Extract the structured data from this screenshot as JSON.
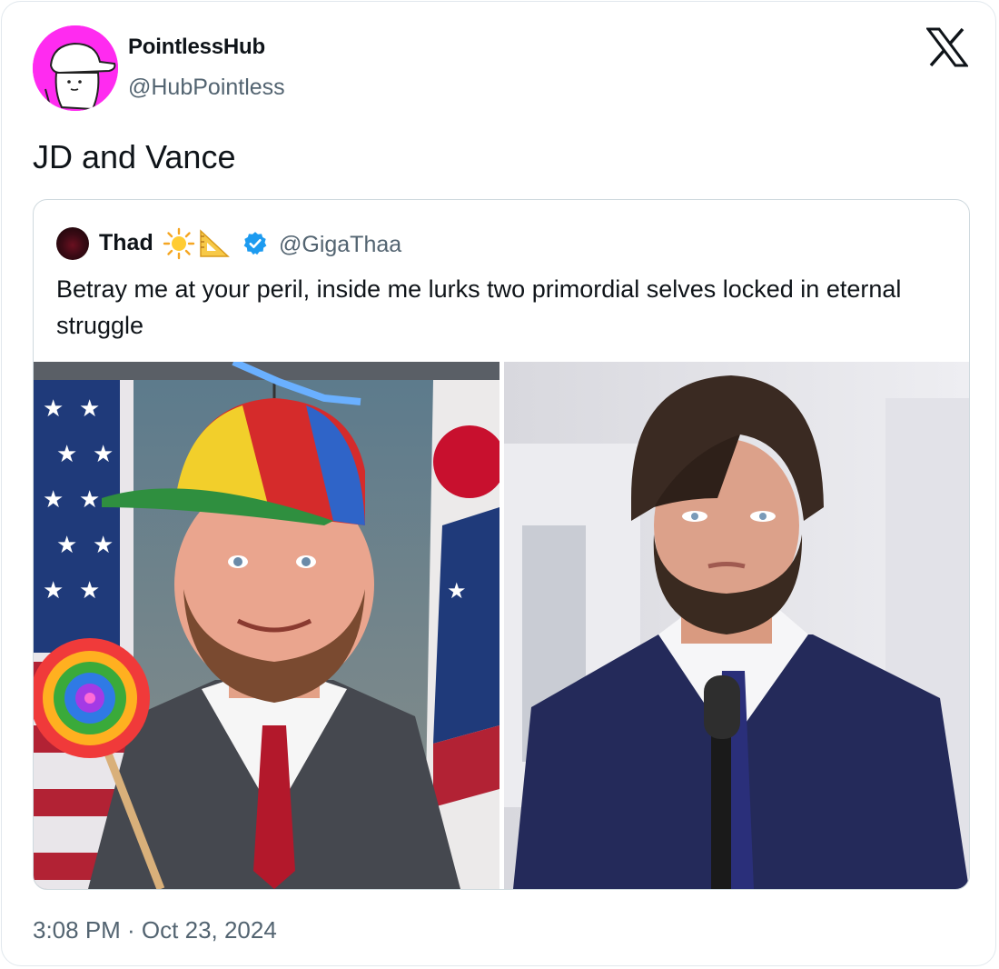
{
  "tweet": {
    "author_name": "PointlessHub",
    "author_handle": "@HubPointless",
    "text": "JD and Vance",
    "timestamp": "3:08 PM · Oct 23, 2024",
    "platform_icon": "x-logo-icon"
  },
  "quoted_tweet": {
    "author_name": "Thad",
    "name_emojis": [
      "☀️",
      "📐"
    ],
    "verified": true,
    "author_handle": "@GigaThaa",
    "text": "Betray me at your peril, inside me lurks two primordial selves locked in eternal struggle",
    "media_count": 2
  },
  "colors": {
    "avatar_bg": "#ff2bf0",
    "verified_blue": "#1d9bf0",
    "secondary_text": "#536471",
    "border": "#cfd9de"
  }
}
